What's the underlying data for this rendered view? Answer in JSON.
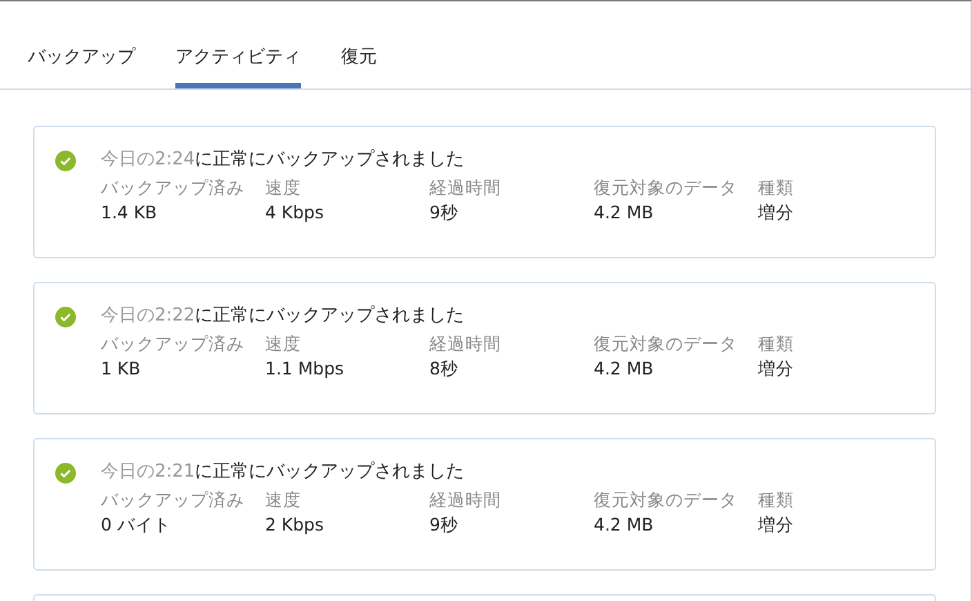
{
  "tabs": [
    {
      "label": "バックアップ",
      "selected": false
    },
    {
      "label": "アクティビティ",
      "selected": true
    },
    {
      "label": "復元",
      "selected": false
    }
  ],
  "entries": [
    {
      "succeeded": true,
      "when": "今日の2:24",
      "message": "に正常にバックアップされました",
      "stats": [
        {
          "label": "バックアップ済み",
          "value": "1.4 KB"
        },
        {
          "label": "速度",
          "value": "4 Kbps"
        },
        {
          "label": "経過時間",
          "value": "9秒"
        },
        {
          "label": "復元対象のデータ",
          "value": "4.2 MB"
        },
        {
          "label": "種類",
          "value": "増分"
        }
      ]
    },
    {
      "succeeded": true,
      "when": "今日の2:22",
      "message": "に正常にバックアップされました",
      "stats": [
        {
          "label": "バックアップ済み",
          "value": "1 KB"
        },
        {
          "label": "速度",
          "value": "1.1 Mbps"
        },
        {
          "label": "経過時間",
          "value": "8秒"
        },
        {
          "label": "復元対象のデータ",
          "value": "4.2 MB"
        },
        {
          "label": "種類",
          "value": "増分"
        }
      ]
    },
    {
      "succeeded": true,
      "when": "今日の2:21",
      "message": "に正常にバックアップされました",
      "stats": [
        {
          "label": "バックアップ済み",
          "value": "0 バイト"
        },
        {
          "label": "速度",
          "value": "2 Kbps"
        },
        {
          "label": "経過時間",
          "value": "9秒"
        },
        {
          "label": "復元対象のデータ",
          "value": "4.2 MB"
        },
        {
          "label": "種類",
          "value": "増分"
        }
      ]
    }
  ]
}
